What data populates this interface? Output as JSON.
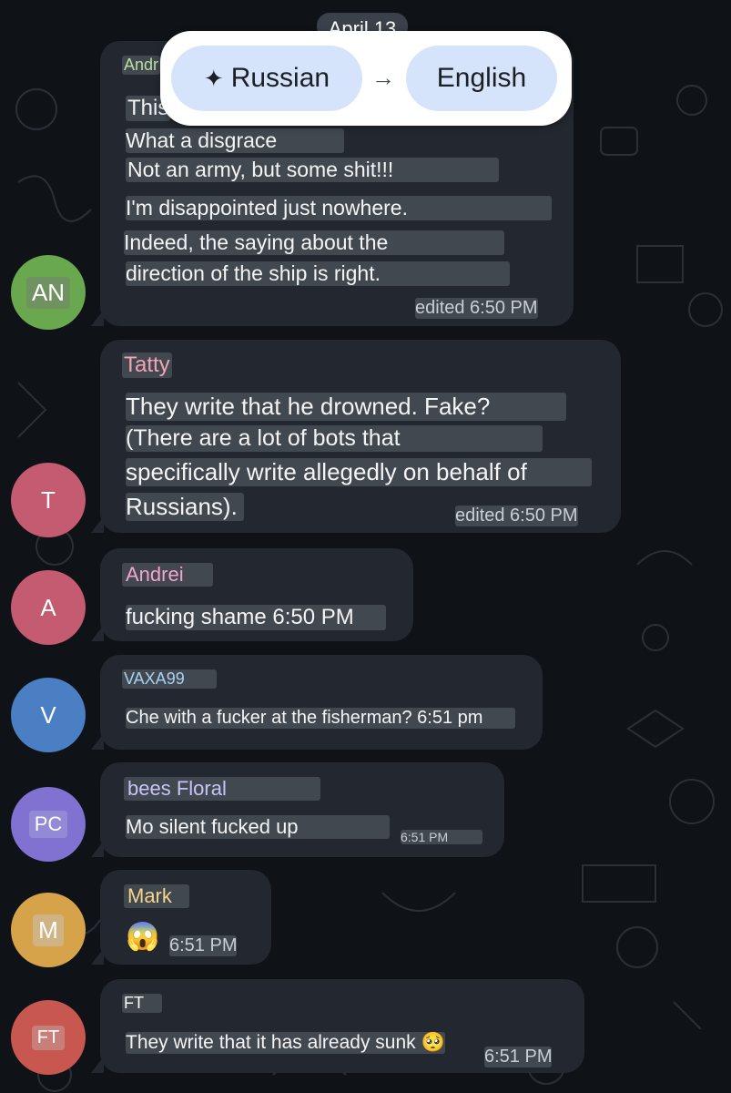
{
  "date_header": "April 13",
  "translate_bar": {
    "from": "Russian",
    "to": "English",
    "arrow": "→",
    "icon": "sparkle-icon"
  },
  "messages": [
    {
      "avatar": "AN",
      "avatar_color": "#6aa84f",
      "name": "Andr",
      "name_color": "#b8e0a0",
      "lines": [
        "This",
        "What a disgrace",
        "Not an army, but some shit!!!",
        "I'm disappointed just nowhere.",
        "Indeed, the saying about the",
        "direction of the ship is right."
      ],
      "time": "edited 6:50 PM"
    },
    {
      "avatar": "T",
      "avatar_color": "#c45b70",
      "name": "Tatty",
      "name_color": "#f2a4b6",
      "lines": [
        "They write that he drowned. Fake?",
        "(There are a lot of bots that",
        "specifically write allegedly on behalf of",
        "Russians)."
      ],
      "time": "edited 6:50 PM"
    },
    {
      "avatar": "A",
      "avatar_color": "#c45b70",
      "name": "Andrei",
      "name_color": "#f2a4d0",
      "lines": [
        "fucking shame 6:50 PM"
      ],
      "time": ""
    },
    {
      "avatar": "V",
      "avatar_color": "#4a7fc4",
      "name": "VAXA99",
      "name_color": "#a7d2f2",
      "lines": [
        "Che with a fucker at the fisherman? 6:51 pm"
      ],
      "time": ""
    },
    {
      "avatar": "PC",
      "avatar_color": "#8172d2",
      "name": "bees Floral",
      "name_color": "#c9c4f7",
      "lines": [
        "Mo silent fucked up"
      ],
      "time": "6:51 PM"
    },
    {
      "avatar": "M",
      "avatar_color": "#d6a24a",
      "name": "Mark",
      "name_color": "#f4d58a",
      "lines": [
        "😱"
      ],
      "time": "6:51 PM"
    },
    {
      "avatar": "FT",
      "avatar_color": "#c8584f",
      "name": "FT",
      "name_color": "#ffffff",
      "lines": [
        "They write that it has already sunk 🥺"
      ],
      "time": "6:51 PM"
    }
  ]
}
